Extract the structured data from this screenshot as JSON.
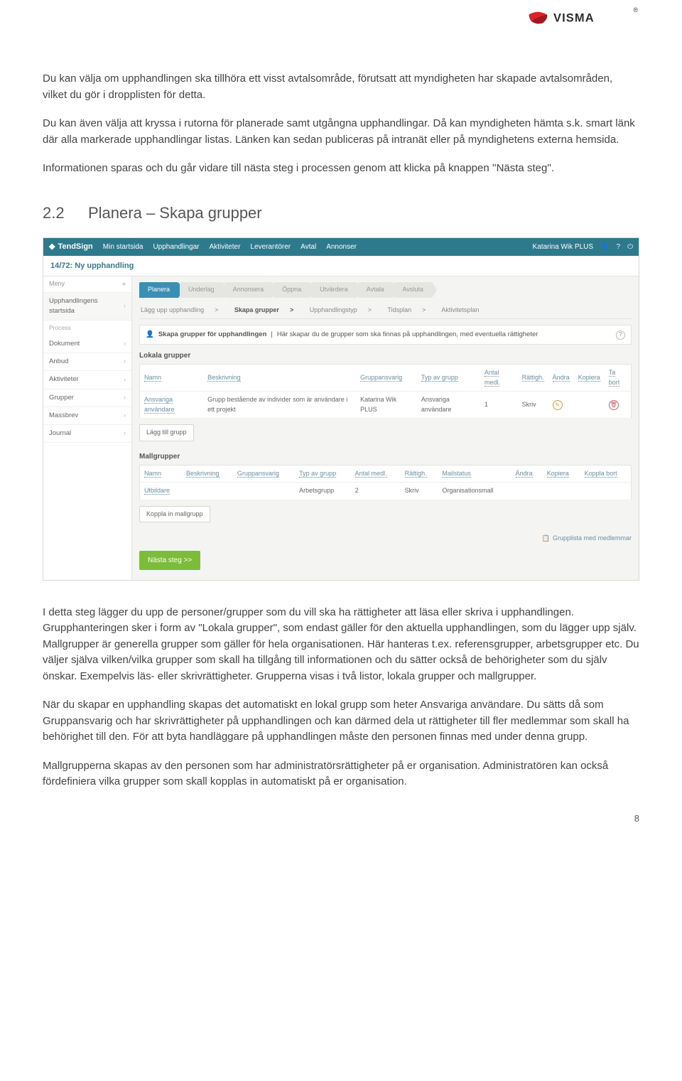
{
  "logo_text": "VISMA",
  "paragraphs": {
    "p1": "Du kan välja om upphandlingen ska tillhöra ett visst avtalsområde, förutsatt att myndigheten har skapade avtalsområden, vilket du gör i dropplisten för detta.",
    "p2": "Du kan även välja att kryssa i rutorna för planerade samt utgångna upphandlingar. Då kan myndigheten hämta s.k. smart länk där alla markerade upphandlingar listas. Länken kan sedan publiceras på intranät eller på myndighetens externa hemsida.",
    "p3": "Informationen sparas och du går vidare till nästa steg i processen genom att klicka på knappen ''Nästa steg''.",
    "p4": "I detta steg lägger du upp de personer/grupper som du vill ska ha rättigheter att läsa eller skriva i upphandlingen. Grupphanteringen sker i form av \"Lokala grupper\", som endast gäller för den aktuella upphandlingen, som du lägger upp själv. Mallgrupper är generella grupper som gäller för hela organisationen. Här hanteras t.ex. referensgrupper, arbetsgrupper etc. Du väljer själva vilken/vilka grupper som skall ha tillgång till informationen och du sätter också de behörigheter som du själv önskar. Exempelvis läs- eller skrivrättigheter. Grupperna visas i två listor, lokala grupper och mallgrupper.",
    "p5": "När du skapar en upphandling skapas det automatiskt en lokal grupp som heter Ansvariga användare. Du sätts då som Gruppansvarig och har skrivrättigheter på upphandlingen och kan därmed dela ut rättigheter till fler medlemmar som skall ha behörighet till den. För att byta handläggare på upphandlingen måste den personen finnas med under denna grupp.",
    "p6": "Mallgrupperna skapas av den personen som har administratörsrättigheter på er organisation. Administratören kan också fördefiniera vilka grupper som skall kopplas in automatiskt på er organisation."
  },
  "section": {
    "number": "2.2",
    "title": "Planera – Skapa grupper"
  },
  "page_number": "8",
  "screenshot": {
    "brand": "TendSign",
    "nav": [
      "Min startsida",
      "Upphandlingar",
      "Aktiviteter",
      "Leverantörer",
      "Avtal",
      "Annonser"
    ],
    "user": "Katarina Wik PLUS",
    "title": "14/72: Ny upphandling",
    "sidebar": {
      "menu_hdr": "Meny",
      "collapse": "«",
      "start": "Upphandlingens startsida",
      "process_label": "Process",
      "items": [
        "Dokument",
        "Anbud",
        "Aktiviteter",
        "Grupper",
        "Massbrev",
        "Journal"
      ]
    },
    "tabs": [
      "Planera",
      "Underlag",
      "Annonsera",
      "Öppna",
      "Utvärdera",
      "Avtala",
      "Avsluta"
    ],
    "subtabs": [
      "Lägg upp upphandling",
      "Skapa grupper",
      "Upphandlingstyp",
      "Tidsplan",
      "Aktivitetsplan"
    ],
    "subtab_seps": ">",
    "info_icon": "👤",
    "info_title": "Skapa grupper för upphandlingen",
    "info_text": "Här skapar du de grupper som ska finnas på upphandlingen, med eventuella rättigheter",
    "help_icon": "?",
    "local_title": "Lokala grupper",
    "local_head": [
      "Namn",
      "Beskrivning",
      "Gruppansvarig",
      "Typ av grupp",
      "Antal medl.",
      "Rättigh.",
      "Ändra",
      "Kopiera",
      "Ta bort"
    ],
    "local_row": {
      "namn": "Ansvariga användare",
      "beskr": "Grupp bestående av individer som är användare i ett projekt",
      "ansv": "Katarina Wik PLUS",
      "typ": "Ansvariga användare",
      "antal": "1",
      "ratt": "Skriv",
      "edit": "✎",
      "del": "🗑"
    },
    "add_local": "Lägg till grupp",
    "mall_title": "Mallgrupper",
    "mall_head": [
      "Namn",
      "Beskrivning",
      "Gruppansvarig",
      "Typ av grupp",
      "Antal medl.",
      "Rättigh.",
      "Mailstatus",
      "Ändra",
      "Kopiera",
      "Koppla bort"
    ],
    "mall_row": {
      "namn": "Utbildare",
      "beskr": "",
      "ansv": "",
      "typ": "Arbetsgrupp",
      "antal": "2",
      "ratt": "Skriv",
      "mail": "Organisationsmall"
    },
    "add_mall": "Koppla in mallgrupp",
    "foot_link": "Grupplista med medlemmar",
    "next": "Nästa steg >>"
  }
}
